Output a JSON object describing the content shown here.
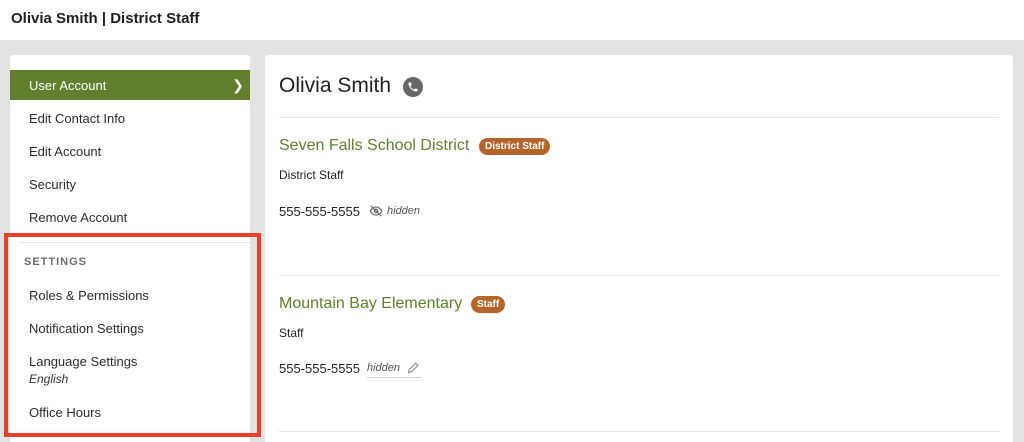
{
  "header": {
    "title": "Olivia Smith | District Staff"
  },
  "sidebar": {
    "items": [
      {
        "label": "User Account"
      },
      {
        "label": "Edit Contact Info"
      },
      {
        "label": "Edit Account"
      },
      {
        "label": "Security"
      },
      {
        "label": "Remove Account"
      }
    ],
    "settings_heading": "SETTINGS",
    "settings_items": [
      {
        "label": "Roles & Permissions"
      },
      {
        "label": "Notification Settings"
      },
      {
        "label": "Language Settings",
        "sublabel": "English"
      },
      {
        "label": "Office Hours"
      }
    ]
  },
  "profile": {
    "name": "Olivia Smith",
    "affiliations": [
      {
        "school": "Seven Falls School District",
        "badge": "District Staff",
        "role": "District Staff",
        "phone": "555-555-5555",
        "phone_status": "hidden"
      },
      {
        "school": "Mountain Bay Elementary",
        "badge": "Staff",
        "role": "Staff",
        "phone": "555-555-5555",
        "phone_status": "hidden"
      }
    ]
  },
  "colors": {
    "accent_green": "#627f2e",
    "badge_orange": "#b6652a",
    "highlight_red": "#e5412b"
  },
  "icons": [
    "chevron-right-icon",
    "phone-icon",
    "eye-slash-icon",
    "pencil-icon"
  ]
}
